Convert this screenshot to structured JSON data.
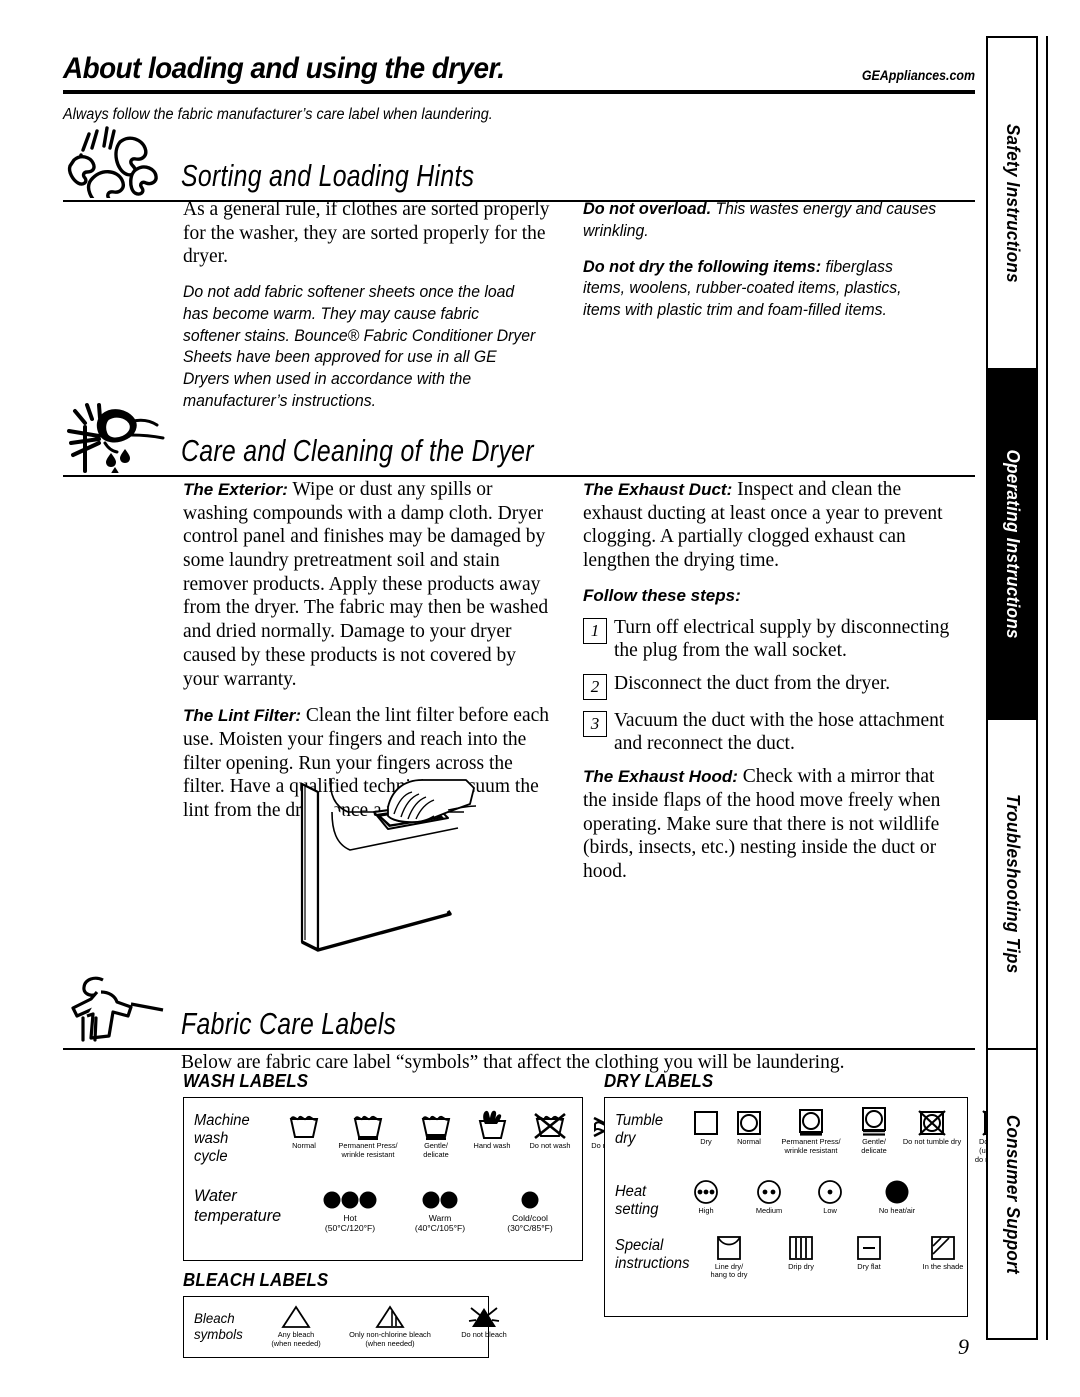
{
  "header": {
    "title": "About loading and using the dryer.",
    "url": "GEAppliances.com",
    "subtitle": "Always follow the fabric manufacturer’s care label when laundering."
  },
  "sections": {
    "sorting": {
      "title": "Sorting and Loading Hints",
      "icon": "tumbling-clothes-icon",
      "left": [
        {
          "style": "serif",
          "text": "As a general rule, if clothes are sorted properly for the washer, they are sorted properly for the dryer."
        },
        {
          "style": "italic",
          "text": "Do not add fabric softener sheets once the load has become warm. They may cause fabric softener stains. Bounce® Fabric Conditioner Dryer Sheets have been approved for use in all GE Dryers when used in accordance with the manufacturer’s instructions."
        }
      ],
      "right": [
        {
          "style": "italic",
          "lead": "Do not overload.",
          "text": " This wastes energy and causes wrinkling."
        },
        {
          "style": "italic",
          "lead": "Do not dry the following items:",
          "text": " fiberglass items, woolens, rubber-coated items, plastics, items with plastic trim and foam-filled items."
        }
      ]
    },
    "care": {
      "title": "Care and Cleaning of the Dryer",
      "icon": "cleaning-cloth-icon",
      "left": [
        {
          "lead": "The Exterior:",
          "text": " Wipe or dust any spills or washing compounds with a damp cloth. Dryer control panel and finishes may be damaged by some laundry pretreatment soil and stain remover products. Apply these products away from the dryer. The fabric may then be washed and dried normally. Damage to your dryer caused by these products is not covered by your warranty."
        },
        {
          "lead": "The Lint Filter:",
          "text": " Clean the lint filter before each use. Moisten your fingers and reach into the filter opening. Run your fingers across the filter. Have a qualified technician vacuum the lint from the dryer once a year."
        }
      ],
      "right_intro": {
        "lead": "The Exhaust Duct:",
        "text": " Inspect and clean the exhaust ducting at least once a year to prevent clogging. A partially clogged exhaust can lengthen the drying time."
      },
      "steps_heading": "Follow these steps:",
      "steps": [
        {
          "num": "1",
          "text": "Turn off electrical supply by disconnecting the plug from the wall socket."
        },
        {
          "num": "2",
          "text": "Disconnect the duct from the dryer."
        },
        {
          "num": "3",
          "text": "Vacuum the duct with the hose attachment and reconnect the duct."
        }
      ],
      "right_outro": {
        "lead": "The Exhaust Hood:",
        "text": " Check with a mirror that the inside flaps of the hood move freely when operating. Make sure that there is not wildlife (birds, insects, etc.) nesting inside the duct or hood."
      },
      "illustration": "dryer-lint-filter-illustration"
    },
    "fabric": {
      "title": "Fabric Care Labels",
      "icon": "shirt-hanger-icon",
      "intro": "Below are fabric care label “symbols” that affect the clothing you will be laundering.",
      "wash": {
        "heading": "WASH LABELS",
        "rows": [
          {
            "label": "Machine\nwash\ncycle",
            "cells": [
              {
                "icon": "washtub-normal-icon",
                "caption": "Normal"
              },
              {
                "icon": "washtub-one-bar-icon",
                "caption": "Permanent Press/\nwrinkle resistant"
              },
              {
                "icon": "washtub-two-bar-icon",
                "caption": "Gentle/\ndelicate"
              },
              {
                "icon": "hand-wash-icon",
                "caption": "Hand wash"
              },
              {
                "icon": "do-not-wash-icon",
                "caption": "Do not wash"
              },
              {
                "icon": "do-not-wring-icon",
                "caption": "Do not wring"
              }
            ]
          },
          {
            "label": "Water\ntemperature",
            "cells": [
              {
                "icon": "three-dots-icon",
                "caption": "Hot\n(50°C/120°F)"
              },
              {
                "icon": "two-dots-icon",
                "caption": "Warm\n(40°C/105°F)"
              },
              {
                "icon": "one-dot-icon",
                "caption": "Cold/cool\n(30°C/85°F)"
              }
            ]
          }
        ]
      },
      "bleach": {
        "heading": "BLEACH LABELS",
        "rows": [
          {
            "label": "Bleach\nsymbols",
            "cells": [
              {
                "icon": "triangle-icon",
                "caption": "Any bleach\n(when needed)"
              },
              {
                "icon": "triangle-stripes-icon",
                "caption": "Only non-chlorine bleach\n(when needed)"
              },
              {
                "icon": "do-not-bleach-icon",
                "caption": "Do not bleach"
              }
            ]
          }
        ]
      },
      "dry": {
        "heading": "DRY LABELS",
        "rows": [
          {
            "label": "Tumble\ndry",
            "cells": [
              {
                "icon": "square-dry-icon",
                "caption": "Dry"
              },
              {
                "icon": "tumble-normal-icon",
                "caption": "Normal"
              },
              {
                "icon": "tumble-one-bar-icon",
                "caption": "Permanent Press/\nwrinkle resistant"
              },
              {
                "icon": "tumble-two-bar-icon",
                "caption": "Gentle/\ndelicate"
              },
              {
                "icon": "do-not-tumble-dry-icon",
                "caption": "Do not tumble dry"
              },
              {
                "icon": "do-not-dry-icon",
                "caption": "Do not dry\n(used with\ndo not wash)"
              }
            ]
          },
          {
            "label": "Heat\nsetting",
            "cells": [
              {
                "icon": "circle-three-dots-icon",
                "caption": "High"
              },
              {
                "icon": "circle-two-dots-icon",
                "caption": "Medium"
              },
              {
                "icon": "circle-one-dot-icon",
                "caption": "Low"
              },
              {
                "icon": "filled-circle-icon",
                "caption": "No heat/air"
              }
            ]
          },
          {
            "label": "Special\ninstructions",
            "cells": [
              {
                "icon": "line-dry-icon",
                "caption": "Line dry/\nhang to dry"
              },
              {
                "icon": "drip-dry-icon",
                "caption": "Drip dry"
              },
              {
                "icon": "dry-flat-icon",
                "caption": "Dry flat"
              },
              {
                "icon": "in-the-shade-icon",
                "caption": "In the shade"
              }
            ]
          }
        ]
      }
    }
  },
  "side_tabs": [
    {
      "label": "Safety Instructions",
      "active": false
    },
    {
      "label": "Operating Instructions",
      "active": true
    },
    {
      "label": "Troubleshooting Tips",
      "active": false
    },
    {
      "label": "Consumer Support",
      "active": false
    }
  ],
  "page_number": "9"
}
